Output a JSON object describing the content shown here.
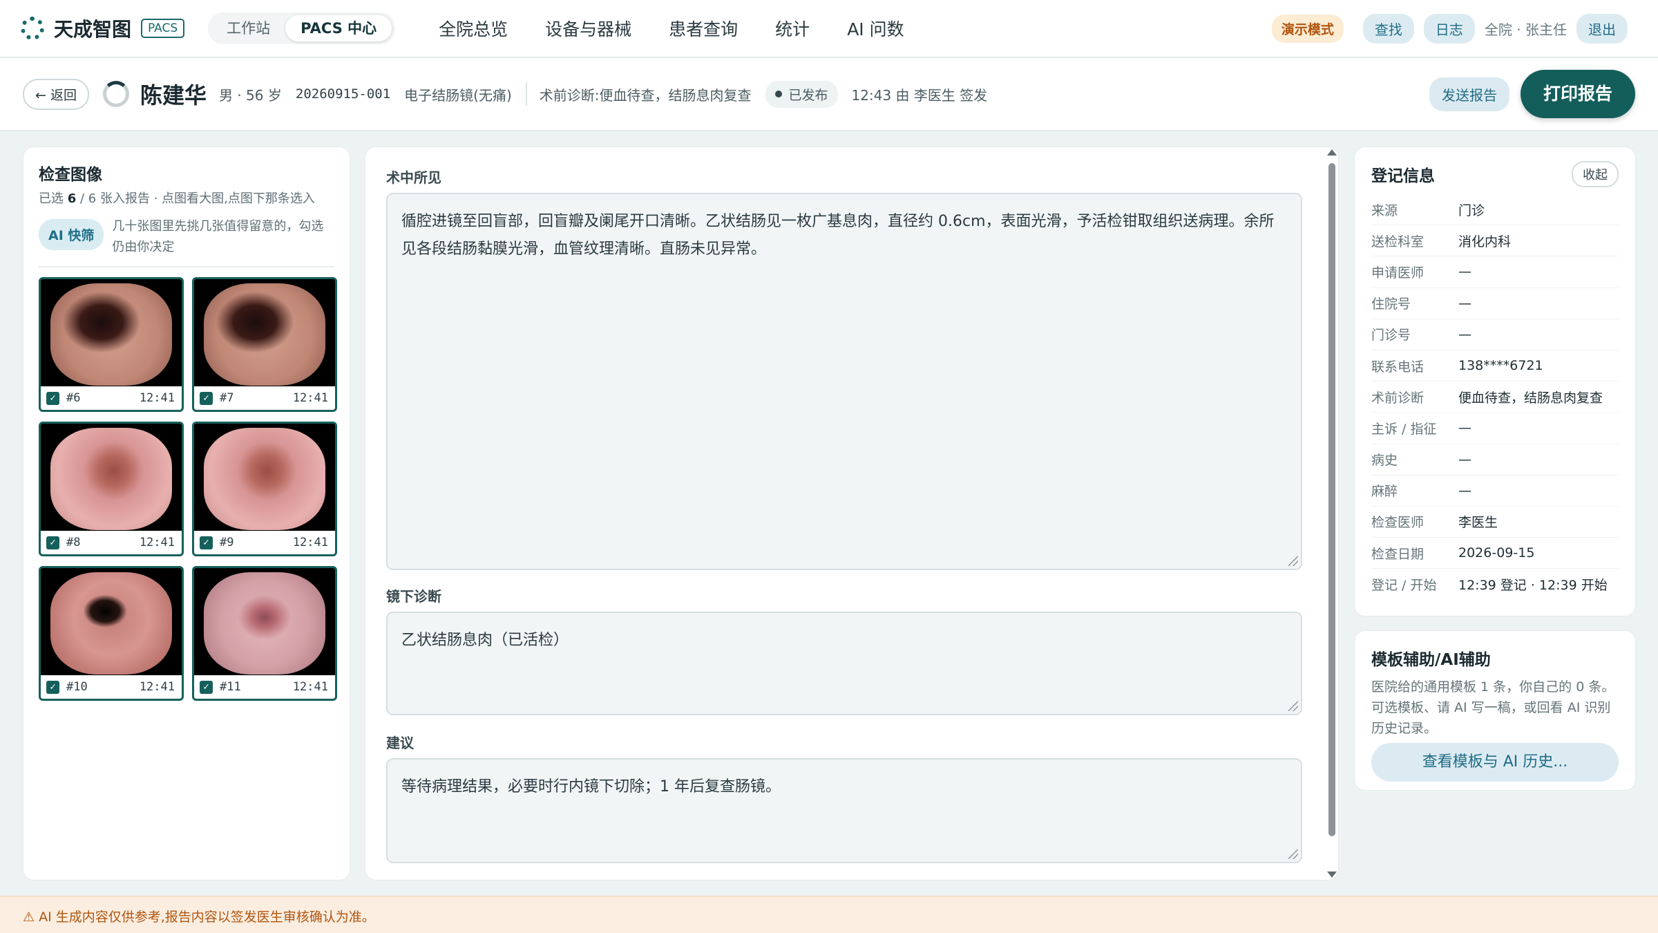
{
  "topbar": {
    "brand": "天成智图",
    "tag": "PACS",
    "nav_pill": [
      "工作站",
      "PACS 中心"
    ],
    "main_nav": [
      "全院总览",
      "设备与器械",
      "患者查询",
      "统计",
      "AI 问数"
    ],
    "demo_mode": "演示模式",
    "find": "查找",
    "log": "日志",
    "user": "全院 · 张主任",
    "logout": "退出"
  },
  "patient": {
    "back": "← 返回",
    "name": "陈建华",
    "info": "男 · 56 岁",
    "exam_id": "20260915-001",
    "exam_type": "电子结肠镜(无痛)",
    "pre_diagnosis": "术前诊断:便血待查，结肠息肉复查",
    "status": "已发布",
    "signed": "12:43 由 李医生 签发",
    "send_report": "发送报告",
    "print_report": "打印报告"
  },
  "images": {
    "title": "检查图像",
    "sub_pre": "已选 ",
    "selected": "6",
    "sub_post": " / 6 张入报告 · 点图看大图,点图下那条选入",
    "ai_button": "AI 快筛",
    "ai_text": "几十张图里先挑几张值得留意的，勾选仍由你决定",
    "thumbs": [
      {
        "label": "#6",
        "time": "12:41"
      },
      {
        "label": "#7",
        "time": "12:41"
      },
      {
        "label": "#8",
        "time": "12:41"
      },
      {
        "label": "#9",
        "time": "12:41"
      },
      {
        "label": "#10",
        "time": "12:41"
      },
      {
        "label": "#11",
        "time": "12:41"
      }
    ]
  },
  "report": {
    "findings_label": "术中所见",
    "findings": "循腔进镜至回盲部，回盲瓣及阑尾开口清晰。乙状结肠见一枚广基息肉，直径约 0.6cm，表面光滑，予活检钳取组织送病理。余所见各段结肠黏膜光滑，血管纹理清晰。直肠未见异常。",
    "diagnosis_label": "镜下诊断",
    "diagnosis": "乙状结肠息肉（已活检）",
    "advice_label": "建议",
    "advice": "等待病理结果，必要时行内镜下切除；1 年后复查肠镜。"
  },
  "registration": {
    "title": "登记信息",
    "collapse": "收起",
    "rows": [
      {
        "k": "来源",
        "v": "门诊"
      },
      {
        "k": "送检科室",
        "v": "消化内科"
      },
      {
        "k": "申请医师",
        "v": "—"
      },
      {
        "k": "住院号",
        "v": "—"
      },
      {
        "k": "门诊号",
        "v": "—"
      },
      {
        "k": "联系电话",
        "v": "138****6721"
      },
      {
        "k": "术前诊断",
        "v": "便血待查，结肠息肉复查"
      },
      {
        "k": "主诉 / 指征",
        "v": "—"
      },
      {
        "k": "病史",
        "v": "—"
      },
      {
        "k": "麻醉",
        "v": "—"
      },
      {
        "k": "检查医师",
        "v": "李医生"
      },
      {
        "k": "检查日期",
        "v": "2026-09-15"
      },
      {
        "k": "登记 / 开始",
        "v": "12:39 登记 · 12:39 开始"
      }
    ]
  },
  "template": {
    "title": "模板辅助/AI辅助",
    "text": "医院给的通用模板 1 条，你自己的 0 条。可选模板、请 AI 写一稿，或回看 AI 识别历史记录。",
    "button": "查看模板与 AI 历史..."
  },
  "footer": {
    "notice": "⚠ AI 生成内容仅供参考,报告内容以签发医生审核确认为准。"
  }
}
